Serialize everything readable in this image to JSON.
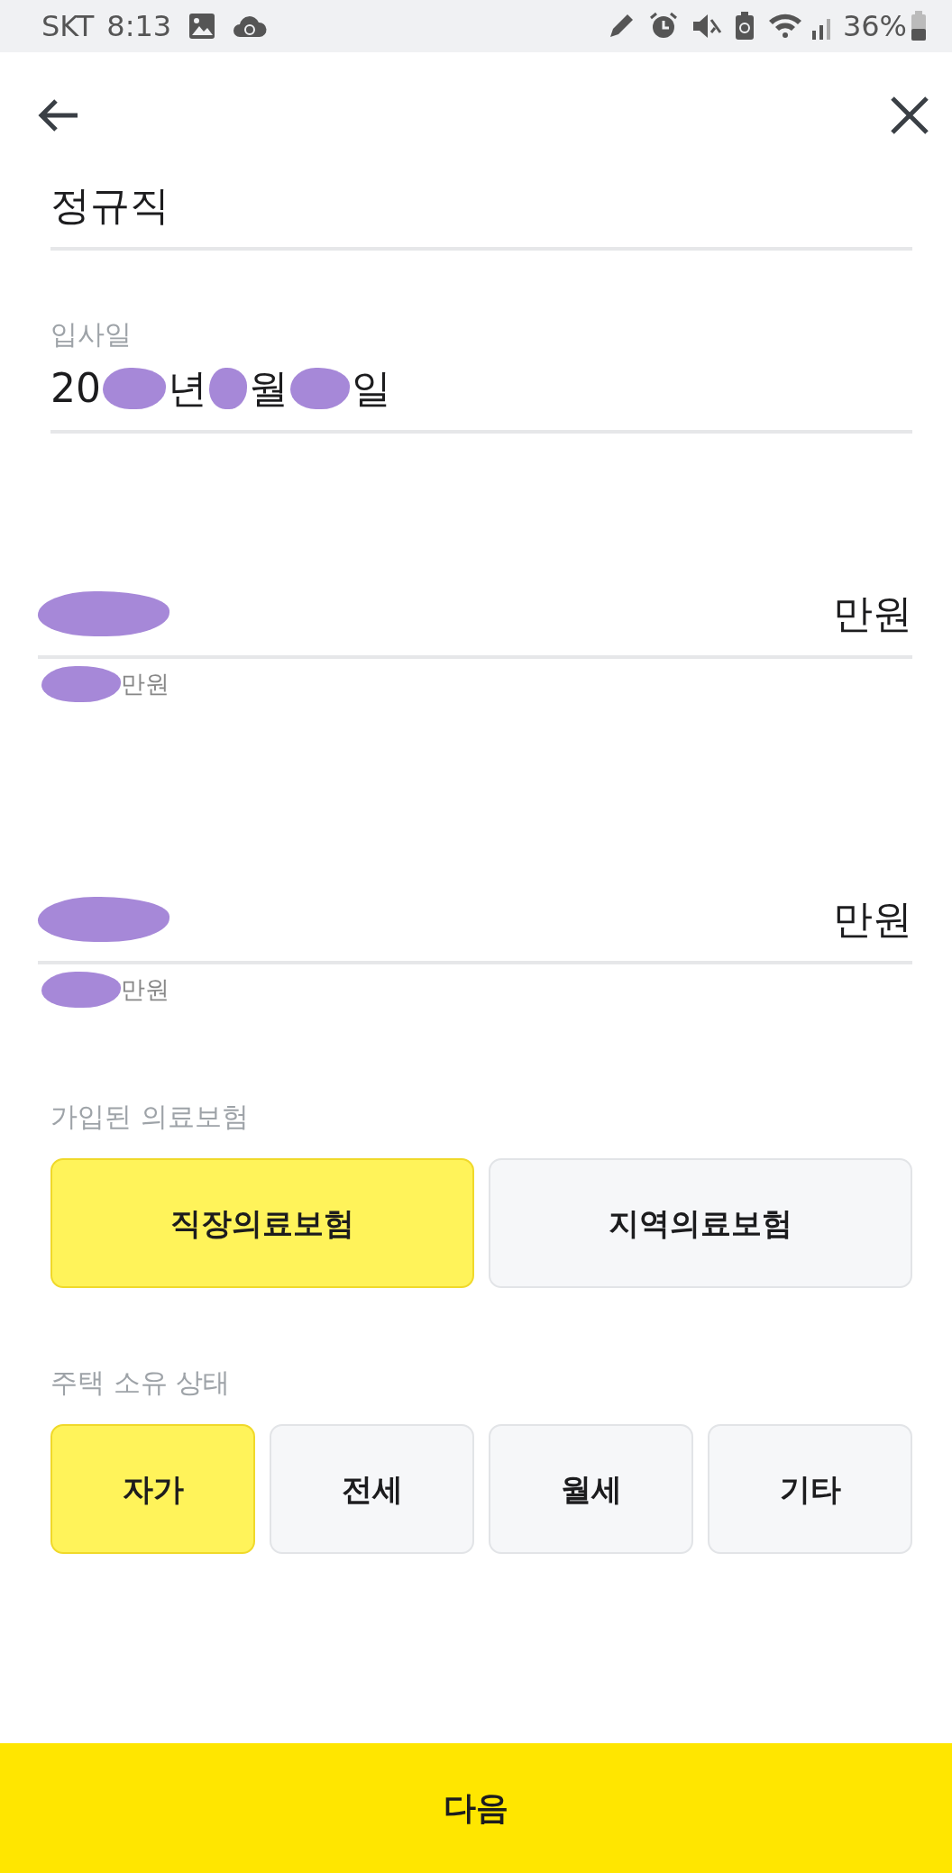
{
  "status_bar": {
    "carrier": "SKT",
    "time": "8:13",
    "battery": "36%"
  },
  "fields": [
    {
      "kind": "text",
      "value": "정규직"
    },
    {
      "kind": "date",
      "label": "입사일",
      "parts": [
        "20",
        "년",
        "월",
        "일"
      ]
    },
    {
      "kind": "amount",
      "unit": "만원",
      "hint_unit": "만원"
    },
    {
      "kind": "amount",
      "unit": "만원",
      "hint_unit": "만원"
    }
  ],
  "choice_groups": [
    {
      "label": "가입된 의료보험",
      "options": [
        {
          "label": "직장의료보험",
          "selected": true
        },
        {
          "label": "지역의료보험",
          "selected": false
        }
      ]
    },
    {
      "label": "주택 소유 상태",
      "options": [
        {
          "label": "자가",
          "selected": true
        },
        {
          "label": "전세",
          "selected": false
        },
        {
          "label": "월세",
          "selected": false
        },
        {
          "label": "기타",
          "selected": false
        }
      ]
    }
  ],
  "next_button": "다음"
}
